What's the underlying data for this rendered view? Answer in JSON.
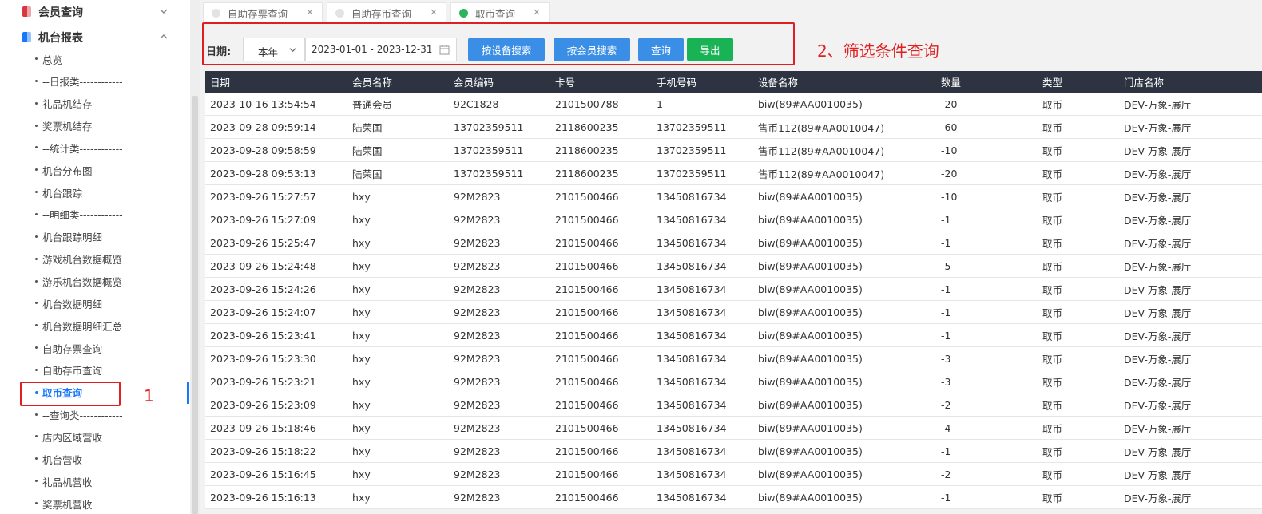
{
  "colors": {
    "accent": "#1677ff",
    "button_blue": "#3a8ee6",
    "button_green": "#19b356",
    "table_header": "#2d3340",
    "annotation_red": "#e02020",
    "group_icon_member": "#d9363e",
    "group_icon_report": "#1677ff"
  },
  "sidebar": {
    "groups": [
      {
        "label": "会员查询",
        "icon": "member-book-icon",
        "state": "collapsed"
      },
      {
        "label": "机台报表",
        "icon": "report-book-icon",
        "state": "expanded"
      }
    ],
    "items": [
      {
        "label": "总览"
      },
      {
        "label": "--日报类------------"
      },
      {
        "label": "礼品机结存"
      },
      {
        "label": "奖票机结存"
      },
      {
        "label": "--统计类------------"
      },
      {
        "label": "机台分布图"
      },
      {
        "label": "机台跟踪"
      },
      {
        "label": "--明细类------------"
      },
      {
        "label": "机台跟踪明细"
      },
      {
        "label": "游戏机台数据概览"
      },
      {
        "label": "游乐机台数据概览"
      },
      {
        "label": "机台数据明细"
      },
      {
        "label": "机台数据明细汇总"
      },
      {
        "label": "自助存票查询"
      },
      {
        "label": "自助存币查询"
      },
      {
        "label": "取币查询",
        "active": true
      },
      {
        "label": "--查询类------------"
      },
      {
        "label": "店内区域营收"
      },
      {
        "label": "机台营收"
      },
      {
        "label": "礼品机营收"
      },
      {
        "label": "奖票机营收"
      }
    ]
  },
  "tabs": [
    {
      "label": "自助存票查询"
    },
    {
      "label": "自助存币查询"
    },
    {
      "label": "取币查询",
      "active": true
    }
  ],
  "filter": {
    "date_label": "日期:",
    "period_value": "本年",
    "date_range": "2023-01-01 - 2023-12-31",
    "btn_device_search": "按设备搜索",
    "btn_member_search": "按会员搜索",
    "btn_query": "查询",
    "btn_export": "导出"
  },
  "annotations": {
    "sidebar_marker": "1",
    "filter_marker": "2、筛选条件查询"
  },
  "table": {
    "columns": [
      "日期",
      "会员名称",
      "会员编码",
      "卡号",
      "手机号码",
      "设备名称",
      "数量",
      "类型",
      "门店名称"
    ],
    "rows": [
      [
        "2023-10-16 13:54:54",
        "普通会员",
        "92C1828",
        "2101500788",
        "1",
        "biw(89#AA0010035)",
        "-20",
        "取币",
        "DEV-万象-展厅"
      ],
      [
        "2023-09-28 09:59:14",
        "陆荣国",
        "13702359511",
        "2118600235",
        "13702359511",
        "售币112(89#AA0010047)",
        "-60",
        "取币",
        "DEV-万象-展厅"
      ],
      [
        "2023-09-28 09:58:59",
        "陆荣国",
        "13702359511",
        "2118600235",
        "13702359511",
        "售币112(89#AA0010047)",
        "-10",
        "取币",
        "DEV-万象-展厅"
      ],
      [
        "2023-09-28 09:53:13",
        "陆荣国",
        "13702359511",
        "2118600235",
        "13702359511",
        "售币112(89#AA0010047)",
        "-20",
        "取币",
        "DEV-万象-展厅"
      ],
      [
        "2023-09-26 15:27:57",
        "hxy",
        "92M2823",
        "2101500466",
        "13450816734",
        "biw(89#AA0010035)",
        "-10",
        "取币",
        "DEV-万象-展厅"
      ],
      [
        "2023-09-26 15:27:09",
        "hxy",
        "92M2823",
        "2101500466",
        "13450816734",
        "biw(89#AA0010035)",
        "-1",
        "取币",
        "DEV-万象-展厅"
      ],
      [
        "2023-09-26 15:25:47",
        "hxy",
        "92M2823",
        "2101500466",
        "13450816734",
        "biw(89#AA0010035)",
        "-1",
        "取币",
        "DEV-万象-展厅"
      ],
      [
        "2023-09-26 15:24:48",
        "hxy",
        "92M2823",
        "2101500466",
        "13450816734",
        "biw(89#AA0010035)",
        "-5",
        "取币",
        "DEV-万象-展厅"
      ],
      [
        "2023-09-26 15:24:26",
        "hxy",
        "92M2823",
        "2101500466",
        "13450816734",
        "biw(89#AA0010035)",
        "-1",
        "取币",
        "DEV-万象-展厅"
      ],
      [
        "2023-09-26 15:24:07",
        "hxy",
        "92M2823",
        "2101500466",
        "13450816734",
        "biw(89#AA0010035)",
        "-1",
        "取币",
        "DEV-万象-展厅"
      ],
      [
        "2023-09-26 15:23:41",
        "hxy",
        "92M2823",
        "2101500466",
        "13450816734",
        "biw(89#AA0010035)",
        "-1",
        "取币",
        "DEV-万象-展厅"
      ],
      [
        "2023-09-26 15:23:30",
        "hxy",
        "92M2823",
        "2101500466",
        "13450816734",
        "biw(89#AA0010035)",
        "-3",
        "取币",
        "DEV-万象-展厅"
      ],
      [
        "2023-09-26 15:23:21",
        "hxy",
        "92M2823",
        "2101500466",
        "13450816734",
        "biw(89#AA0010035)",
        "-3",
        "取币",
        "DEV-万象-展厅"
      ],
      [
        "2023-09-26 15:23:09",
        "hxy",
        "92M2823",
        "2101500466",
        "13450816734",
        "biw(89#AA0010035)",
        "-2",
        "取币",
        "DEV-万象-展厅"
      ],
      [
        "2023-09-26 15:18:46",
        "hxy",
        "92M2823",
        "2101500466",
        "13450816734",
        "biw(89#AA0010035)",
        "-4",
        "取币",
        "DEV-万象-展厅"
      ],
      [
        "2023-09-26 15:18:22",
        "hxy",
        "92M2823",
        "2101500466",
        "13450816734",
        "biw(89#AA0010035)",
        "-1",
        "取币",
        "DEV-万象-展厅"
      ],
      [
        "2023-09-26 15:16:45",
        "hxy",
        "92M2823",
        "2101500466",
        "13450816734",
        "biw(89#AA0010035)",
        "-2",
        "取币",
        "DEV-万象-展厅"
      ],
      [
        "2023-09-26 15:16:13",
        "hxy",
        "92M2823",
        "2101500466",
        "13450816734",
        "biw(89#AA0010035)",
        "-1",
        "取币",
        "DEV-万象-展厅"
      ]
    ]
  }
}
